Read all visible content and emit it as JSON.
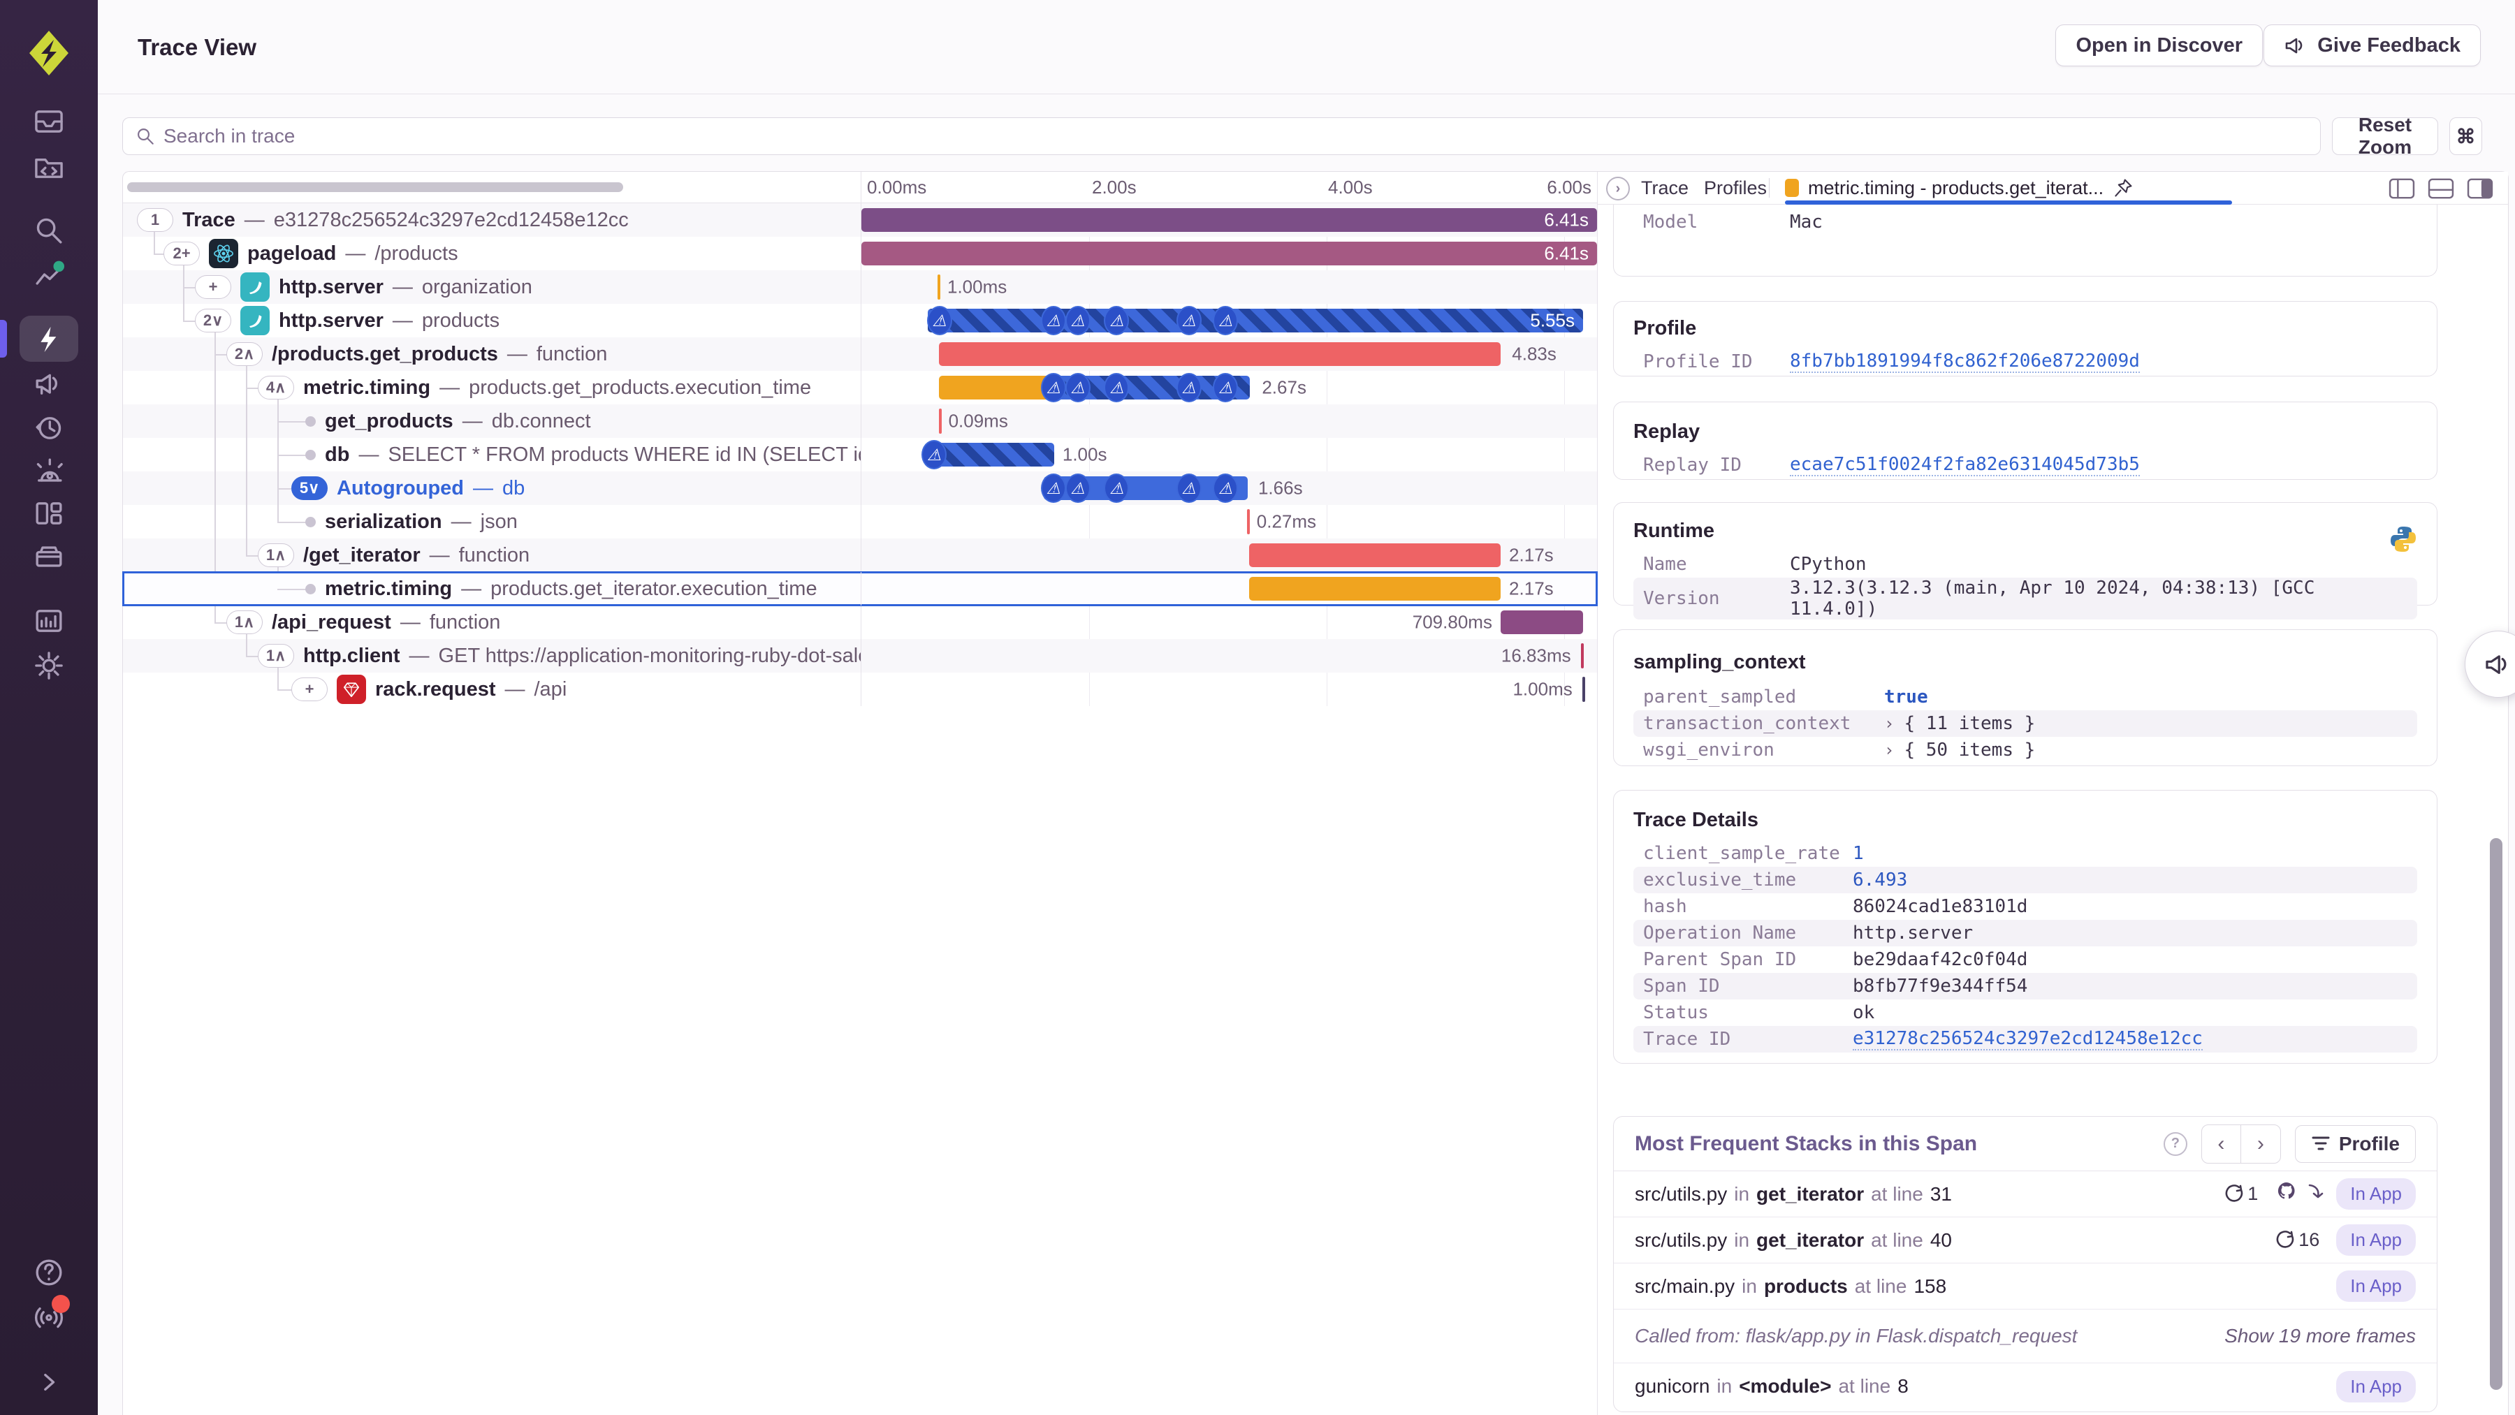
{
  "header": {
    "title": "Trace View",
    "open_in_discover": "Open in Discover",
    "give_feedback": "Give Feedback"
  },
  "toolbar": {
    "search_placeholder": "Search in trace",
    "reset_zoom": "Reset Zoom",
    "cmd": "⌘"
  },
  "timeline": {
    "ticks": [
      "0.00ms",
      "2.00s",
      "4.00s",
      "6.00s"
    ]
  },
  "misc": {
    "separator": "—",
    "in_word": "in",
    "at_line": "at line",
    "expander": "›",
    "collapse": "›"
  },
  "rows": [
    {
      "badge": "1",
      "op": "Trace",
      "desc": "e31278c256524c3297e2cd12458e12cc",
      "duration": "6.41s"
    },
    {
      "badge": "2+",
      "op": "pageload",
      "desc": "/products",
      "duration": "6.41s"
    },
    {
      "badge": "+",
      "op": "http.server",
      "desc": "organization",
      "duration": "1.00ms"
    },
    {
      "badge": "2∨",
      "op": "http.server",
      "desc": "products",
      "duration": "5.55s"
    },
    {
      "badge": "2∧",
      "op": "/products.get_products",
      "desc": "function",
      "duration": "4.83s"
    },
    {
      "badge": "4∧",
      "op": "metric.timing",
      "desc": "products.get_products.execution_time",
      "duration": "2.67s"
    },
    {
      "badge": "",
      "op": "get_products",
      "desc": "db.connect",
      "duration": "0.09ms"
    },
    {
      "badge": "",
      "op": "db",
      "desc": "SELECT * FROM products WHERE id IN (SELECT id from produ",
      "duration": "1.00s"
    },
    {
      "badge": "5∨",
      "op": "Autogrouped",
      "desc": "db",
      "duration": "1.66s"
    },
    {
      "badge": "",
      "op": "serialization",
      "desc": "json",
      "duration": "0.27ms"
    },
    {
      "badge": "1∧",
      "op": "/get_iterator",
      "desc": "function",
      "duration": "2.17s"
    },
    {
      "badge": "",
      "op": "metric.timing",
      "desc": "products.get_iterator.execution_time",
      "duration": "2.17s"
    },
    {
      "badge": "1∧",
      "op": "/api_request",
      "desc": "function",
      "duration": "709.80ms"
    },
    {
      "badge": "1∧",
      "op": "http.client",
      "desc": "GET https://application-monitoring-ruby-dot-sales-eng",
      "duration": "16.83ms"
    },
    {
      "badge": "+",
      "op": "rack.request",
      "desc": "/api",
      "duration": "1.00ms"
    }
  ],
  "tabs": {
    "trace": "Trace",
    "profiles": "Profiles",
    "active": "metric.timing - products.get_iterat..."
  },
  "cards": {
    "model": {
      "rows": [
        {
          "k": "Model",
          "v": "Mac"
        }
      ]
    },
    "profile": {
      "title": "Profile",
      "rows": [
        {
          "k": "Profile ID",
          "v": "8fb7bb1891994f8c862f206e8722009d"
        }
      ]
    },
    "replay": {
      "title": "Replay",
      "rows": [
        {
          "k": "Replay ID",
          "v": "ecae7c51f0024f2fa82e6314045d73b5"
        }
      ]
    },
    "runtime": {
      "title": "Runtime",
      "rows": [
        {
          "k": "Name",
          "v": "CPython"
        },
        {
          "k": "Version",
          "v": "3.12.3(3.12.3 (main, Apr 10 2024, 04:38:13) [GCC 11.4.0])"
        }
      ]
    },
    "sampling": {
      "title": "sampling_context",
      "rows": [
        {
          "k": "parent_sampled",
          "v": "true"
        },
        {
          "k": "transaction_context",
          "v": "{ 11 items }"
        },
        {
          "k": "wsgi_environ",
          "v": "{ 50 items }"
        }
      ]
    },
    "trace_details": {
      "title": "Trace Details",
      "rows": [
        {
          "k": "client_sample_rate",
          "v": "1"
        },
        {
          "k": "exclusive_time",
          "v": "6.493"
        },
        {
          "k": "hash",
          "v": "86024cad1e83101d"
        },
        {
          "k": "Operation Name",
          "v": "http.server"
        },
        {
          "k": "Parent Span ID",
          "v": "be29daaf42c0f04d"
        },
        {
          "k": "Span ID",
          "v": "b8fb77f9e344ff54"
        },
        {
          "k": "Status",
          "v": "ok"
        },
        {
          "k": "Trace ID",
          "v": "e31278c256524c3297e2cd12458e12cc"
        }
      ]
    },
    "stacks": {
      "title": "Most Frequent Stacks in this Span",
      "profile_button": "Profile",
      "rows": [
        {
          "file": "src/utils.py",
          "func": "get_iterator",
          "line": "31",
          "count": "1",
          "badge": "In App"
        },
        {
          "file": "src/utils.py",
          "func": "get_iterator",
          "line": "40",
          "count": "16",
          "badge": "In App"
        },
        {
          "file": "src/main.py",
          "func": "products",
          "line": "158",
          "badge": "In App"
        },
        {
          "called": "Called from: flask/app.py in Flask.dispatch_request",
          "more": "Show 19 more frames"
        },
        {
          "file": "gunicorn",
          "func": "<module>",
          "line": "8",
          "badge": "In App"
        }
      ]
    }
  }
}
